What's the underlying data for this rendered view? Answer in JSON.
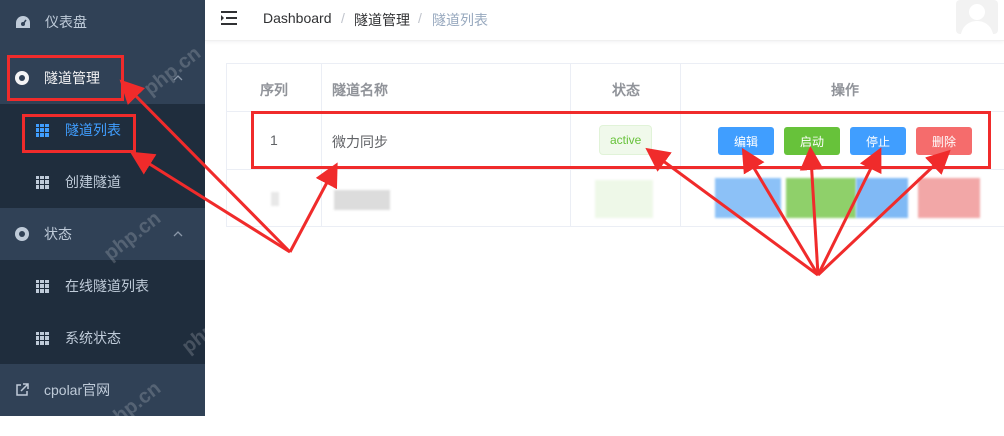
{
  "sidebar": {
    "items": [
      {
        "label": "仪表盘",
        "icon": "dashboard-icon"
      },
      {
        "label": "隧道管理",
        "icon": "tunnel-manage-icon"
      },
      {
        "label": "隧道列表",
        "icon": "grid-icon"
      },
      {
        "label": "创建隧道",
        "icon": "grid-icon"
      },
      {
        "label": "状态",
        "icon": "status-icon"
      },
      {
        "label": "在线隧道列表",
        "icon": "grid-icon"
      },
      {
        "label": "系统状态",
        "icon": "grid-icon"
      },
      {
        "label": "cpolar官网",
        "icon": "external-link-icon"
      }
    ]
  },
  "watermark": "php.cn",
  "header": {
    "breadcrumb": [
      "Dashboard",
      "隧道管理",
      "隧道列表"
    ],
    "separator": "/"
  },
  "table": {
    "columns": [
      "序列",
      "隧道名称",
      "状态",
      "操作"
    ],
    "rows": [
      {
        "index": "1",
        "name": "微力同步",
        "status": "active",
        "actions": [
          "编辑",
          "启动",
          "停止",
          "删除"
        ]
      }
    ]
  },
  "colors": {
    "sidebar_bg": "#304156",
    "submenu_bg": "#1f2d3d",
    "active_text": "#409eff",
    "primary": "#409eff",
    "success": "#67c23a",
    "danger": "#f56c6c",
    "annotation": "#f02b2b"
  }
}
